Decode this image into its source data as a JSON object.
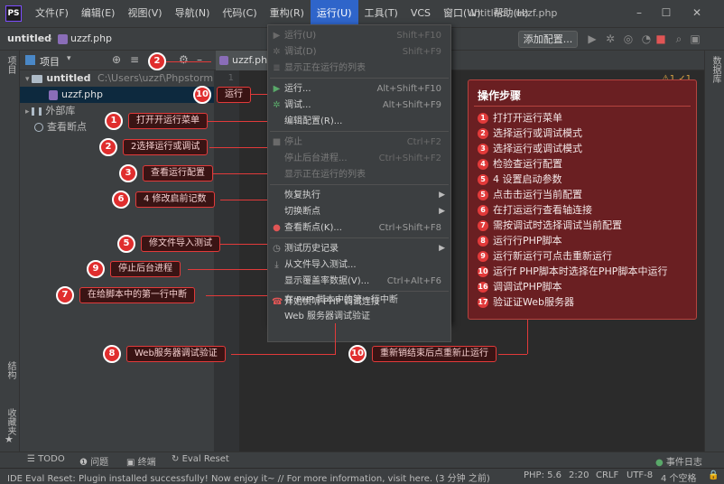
{
  "menubar": {
    "items": [
      "文件(F)",
      "编辑(E)",
      "视图(V)",
      "导航(N)",
      "代码(C)",
      "重构(R)",
      "运行(U)",
      "工具(T)",
      "VCS",
      "窗口(W)",
      "帮助(H)"
    ],
    "window_title": "untitled - uzzf.php"
  },
  "navbar": {
    "project": "untitled",
    "file": "uzzf.php",
    "add_config": "添加配置..."
  },
  "project_panel": {
    "title": "项目",
    "tree": [
      {
        "label": "untitled",
        "path": "C:\\Users\\uzzf\\PhpstormPro"
      },
      {
        "label": "uzzf.php"
      },
      {
        "label": "外部库"
      },
      {
        "label": "查看断点"
      }
    ]
  },
  "editor": {
    "tab": "uzzf.php",
    "line_number": "1",
    "inspect": "⚠1 ✓1"
  },
  "run_menu": {
    "items": [
      {
        "label": "运行(U)",
        "shortcut": "Shift+F10",
        "disabled": true
      },
      {
        "label": "调试(D)",
        "shortcut": "Shift+F9",
        "disabled": true
      },
      {
        "label": "显示正在运行的列表",
        "shortcut": "",
        "disabled": true
      },
      {
        "label": "运行...",
        "shortcut": "Alt+Shift+F10",
        "disabled": false
      },
      {
        "label": "调试...",
        "shortcut": "Alt+Shift+F9",
        "disabled": false
      },
      {
        "label": "编辑配置(R)...",
        "shortcut": "",
        "disabled": false
      },
      {
        "label": "停止",
        "shortcut": "Ctrl+F2",
        "disabled": true
      },
      {
        "label": "停止后台进程...",
        "shortcut": "Ctrl+Shift+F2",
        "disabled": true
      },
      {
        "label": "显示正在运行的列表",
        "shortcut": "",
        "disabled": true
      },
      {
        "label": "恢复执行",
        "shortcut": "",
        "disabled": false
      },
      {
        "label": "切换断点",
        "shortcut": "",
        "disabled": false
      },
      {
        "label": "查看断点(K)...",
        "shortcut": "Ctrl+Shift+F8",
        "disabled": false
      },
      {
        "label": "测试历史记录",
        "shortcut": "",
        "disabled": false
      },
      {
        "label": "从文件导入测试...",
        "shortcut": "",
        "disabled": false
      },
      {
        "label": "显示覆盖率数据(V)...",
        "shortcut": "Ctrl+Alt+F6",
        "disabled": false
      },
      {
        "label": "开始侦听 PHP 调试连接",
        "shortcut": "",
        "disabled": false
      },
      {
        "label": "在 PHP 脚本中的第一行中断",
        "shortcut": "",
        "disabled": false
      },
      {
        "label": "Web 服务器调试验证",
        "shortcut": "",
        "disabled": false
      }
    ]
  },
  "steps_panel": {
    "title": "操作步骤",
    "steps": [
      {
        "num": "1",
        "text": "打打开运行菜单"
      },
      {
        "num": "2",
        "text": "选择运行或调试模式"
      },
      {
        "num": "3",
        "text": "选择运行或调试模式"
      },
      {
        "num": "4",
        "text": "检验查运行配置"
      },
      {
        "num": "5",
        "text": "4 设置启动参数"
      },
      {
        "num": "5",
        "text": "点击击运行当前配置"
      },
      {
        "num": "6",
        "text": "在打运运行查看轴连接"
      },
      {
        "num": "7",
        "text": "需按调试时选择调试当前配置"
      },
      {
        "num": "8",
        "text": "运行行PHP脚本"
      },
      {
        "num": "9",
        "text": "运行新运行可点击重新运行"
      },
      {
        "num": "10",
        "text": "运行f PHP脚本时选择在PHP脚本中运行"
      },
      {
        "num": "16",
        "text": "调调试PHP脚本"
      },
      {
        "num": "17",
        "text": "验证证Web服务器"
      }
    ]
  },
  "callouts": [
    {
      "num": "2",
      "text": ""
    },
    {
      "num": "10",
      "text": "运行"
    },
    {
      "num": "1",
      "text": "打开开运行菜单"
    },
    {
      "num": "2",
      "text": "2选择运行或调试"
    },
    {
      "num": "3",
      "text": "查看运行配置"
    },
    {
      "num": "6",
      "text": "4 修改启前记数"
    },
    {
      "num": "5",
      "text": "修文件导入测试"
    },
    {
      "num": "9",
      "text": "停止后台进程"
    },
    {
      "num": "7",
      "text": "在给脚本中的第一行中断"
    },
    {
      "num": "8",
      "text": "Web服务器调试验证"
    },
    {
      "num": "10",
      "text": "重新销结束后点重新止运行"
    }
  ],
  "bottom_tools": {
    "todo": "TODO",
    "problems": "问题",
    "terminal": "终端",
    "eval_reset": "Eval Reset",
    "event_log": "事件日志"
  },
  "left_strip": {
    "project": "项目",
    "structure": "结构",
    "favorites": "收藏夹"
  },
  "right_strip": {
    "database": "数据库"
  },
  "statusbar": {
    "message": "IDE Eval Reset: Plugin installed successfully! Now enjoy it~ // For more information, visit here. (3 分钟 之前)",
    "php": "PHP: 5.6",
    "position": "2:20",
    "line_sep": "CRLF",
    "encoding": "UTF-8",
    "indent": "4 个空格"
  },
  "colors": {
    "accent": "#2f65ca",
    "callout": "#e02e2e",
    "steps_bg": "#6a1f22"
  }
}
